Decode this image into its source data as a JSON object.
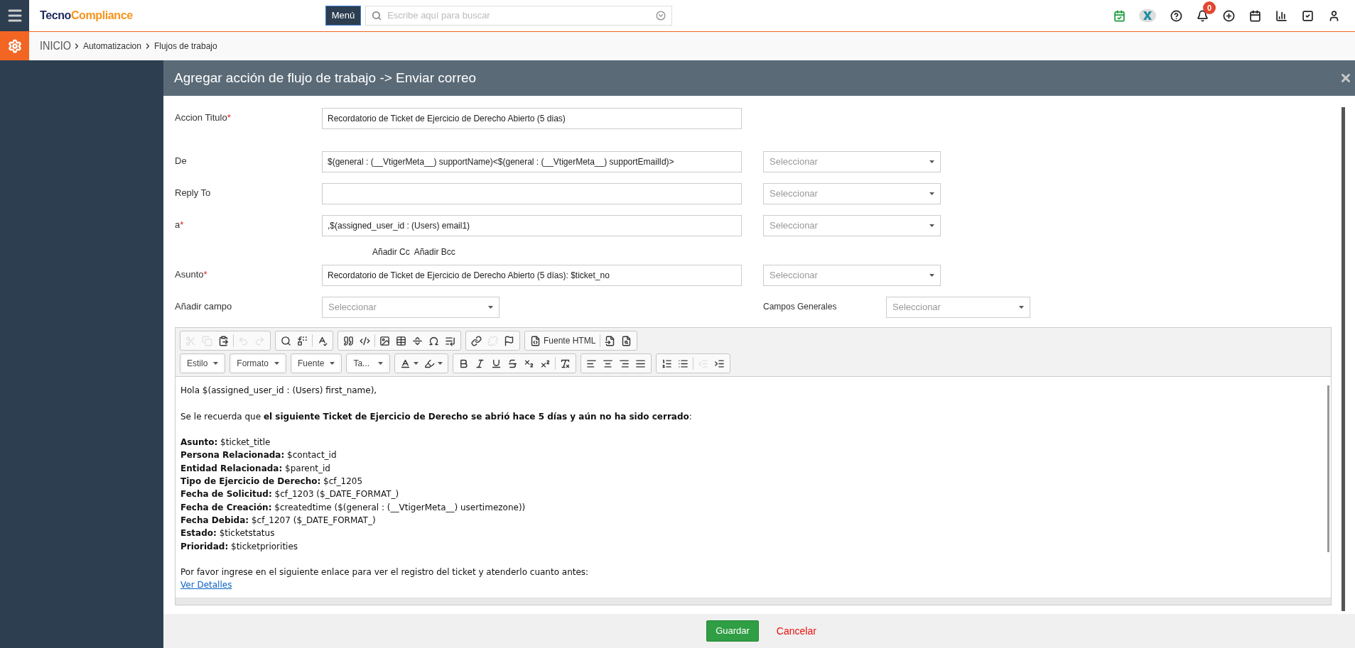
{
  "header": {
    "logo": {
      "first": "Tecno",
      "second": "Compliance"
    },
    "menu_button": "Menú",
    "search": {
      "placeholder": "Escribe aquí para buscar"
    },
    "icons": [
      {
        "kind": "calendar-check"
      },
      {
        "kind": "brand"
      },
      {
        "kind": "help"
      },
      {
        "kind": "bell",
        "badge": "0"
      },
      {
        "kind": "add"
      },
      {
        "kind": "calendar"
      },
      {
        "kind": "chart"
      },
      {
        "kind": "task"
      },
      {
        "kind": "user"
      }
    ]
  },
  "breadcrumb": [
    "INICIO",
    "Automatizacion",
    "Flujos de trabajo"
  ],
  "dialog": {
    "title": "Agregar acción de flujo de trabajo -> Enviar correo",
    "fields": [
      {
        "label": "Accion Titulo",
        "required": true,
        "value": "Recordatorio de Ticket de Ejercicio de Derecho Abierto (5 dias)"
      },
      {
        "label": "De",
        "required": false,
        "value": "$(general : (__VtigerMeta__) supportName)<$(general : (__VtigerMeta__) supportEmailId)>",
        "select": {
          "placeholder": "Seleccionar"
        }
      },
      {
        "label": "Reply To",
        "required": false,
        "select": {
          "placeholder": "Seleccionar"
        }
      },
      {
        "label": "a",
        "required": true,
        "value": ",$(assigned_user_id : (Users) email1)",
        "select": {
          "placeholder": "Seleccionar"
        }
      },
      {
        "label": "Asunto",
        "required": true,
        "value": "Recordatorio de Ticket de Ejercicio de Derecho Abierto (5 días): $ticket_no",
        "select": {
          "placeholder": "Seleccionar"
        }
      }
    ],
    "required_marker": "*",
    "cc_links": [
      "Añadir Cc",
      "Añadir Bcc"
    ],
    "add_field": {
      "label": "Añadir campo",
      "placeholder": "Seleccionar"
    },
    "general_fields": {
      "label": "Campos Generales",
      "placeholder": "Seleccionar"
    },
    "toolbar": [
      [
        [
          {
            "kind": "cut",
            "disabled": true
          },
          {
            "kind": "copy",
            "disabled": true
          },
          {
            "kind": "paste",
            "disabled": false
          },
          {
            "kind": "sep"
          },
          {
            "kind": "undo",
            "disabled": true
          },
          {
            "kind": "redo",
            "disabled": true
          }
        ],
        [
          {
            "kind": "find",
            "disabled": false
          },
          {
            "kind": "replace",
            "disabled": false
          },
          {
            "kind": "sep"
          },
          {
            "kind": "spellcheck",
            "disabled": false
          }
        ],
        [
          {
            "kind": "quote",
            "disabled": false
          },
          {
            "kind": "div",
            "disabled": false
          },
          {
            "kind": "sep"
          },
          {
            "kind": "image",
            "disabled": false
          },
          {
            "kind": "table",
            "disabled": false
          },
          {
            "kind": "rule",
            "disabled": false
          },
          {
            "kind": "symbol",
            "disabled": false
          },
          {
            "kind": "blocks",
            "disabled": false
          }
        ],
        [
          {
            "kind": "link",
            "disabled": false
          },
          {
            "kind": "unlink",
            "disabled": true
          },
          {
            "kind": "anchor",
            "disabled": false
          }
        ],
        [
          {
            "kind": "source",
            "disabled": false,
            "label": "Fuente HTML"
          },
          {
            "kind": "sep"
          },
          {
            "kind": "templates",
            "disabled": false
          },
          {
            "kind": "preview",
            "disabled": false
          }
        ]
      ],
      [
        [
          {
            "kind": "dropdown",
            "label": "Estilo"
          }
        ],
        [
          {
            "kind": "dropdown",
            "label": "Formato"
          }
        ],
        [
          {
            "kind": "dropdown",
            "label": "Fuente"
          }
        ],
        [
          {
            "kind": "dropdown",
            "label": "Ta..."
          }
        ],
        [
          {
            "kind": "textcolor",
            "disabled": false
          },
          {
            "kind": "bgcolor",
            "disabled": false
          }
        ],
        [
          {
            "kind": "bold",
            "disabled": false
          },
          {
            "kind": "italic",
            "disabled": false
          },
          {
            "kind": "underline",
            "disabled": false
          },
          {
            "kind": "strike",
            "disabled": false
          },
          {
            "kind": "subscript",
            "disabled": false
          },
          {
            "kind": "superscript",
            "disabled": false
          },
          {
            "kind": "sep"
          },
          {
            "kind": "clear",
            "disabled": false
          }
        ],
        [
          {
            "kind": "left",
            "disabled": false
          },
          {
            "kind": "center",
            "disabled": false
          },
          {
            "kind": "right",
            "disabled": false
          },
          {
            "kind": "justify",
            "disabled": false
          }
        ],
        [
          {
            "kind": "numbered",
            "disabled": false
          },
          {
            "kind": "bulleted",
            "disabled": false
          },
          {
            "kind": "sep"
          },
          {
            "kind": "outdent",
            "disabled": true
          },
          {
            "kind": "indent",
            "disabled": false
          }
        ]
      ]
    ],
    "body": [
      {
        "kind": "line",
        "text": "Hola $(assigned_user_id : (Users) first_name),"
      },
      {
        "kind": "blank"
      },
      {
        "kind": "line",
        "text": "Se le recuerda que **el siguiente Ticket de Ejercicio de Derecho se abrió hace 5 días y aún no ha sido cerrado**:"
      },
      {
        "kind": "blank"
      },
      {
        "kind": "line",
        "text": "**Asunto:** $ticket_title"
      },
      {
        "kind": "line",
        "text": "**Persona Relacionada:** $contact_id"
      },
      {
        "kind": "line",
        "text": "**Entidad Relacionada:** $parent_id"
      },
      {
        "kind": "line",
        "text": "**Tipo de Ejercicio de Derecho:** $cf_1205"
      },
      {
        "kind": "line",
        "text": "**Fecha de Solicitud:** $cf_1203 ($_DATE_FORMAT_)"
      },
      {
        "kind": "line",
        "text": "**Fecha de Creación:** $createdtime ($(general : (__VtigerMeta__) usertimezone))"
      },
      {
        "kind": "line",
        "text": "**Fecha Debida:** $cf_1207 ($_DATE_FORMAT_)"
      },
      {
        "kind": "line",
        "text": "**Estado:** $ticketstatus"
      },
      {
        "kind": "line",
        "text": "**Prioridad:** $ticketpriorities"
      },
      {
        "kind": "blank"
      },
      {
        "kind": "line",
        "text": "Por favor ingrese en el siguiente enlace para ver el registro del ticket y atenderlo cuanto antes:"
      },
      {
        "kind": "link",
        "text": "Ver Detalles"
      }
    ],
    "save_button": "Guardar",
    "cancel_link": "Cancelar"
  }
}
